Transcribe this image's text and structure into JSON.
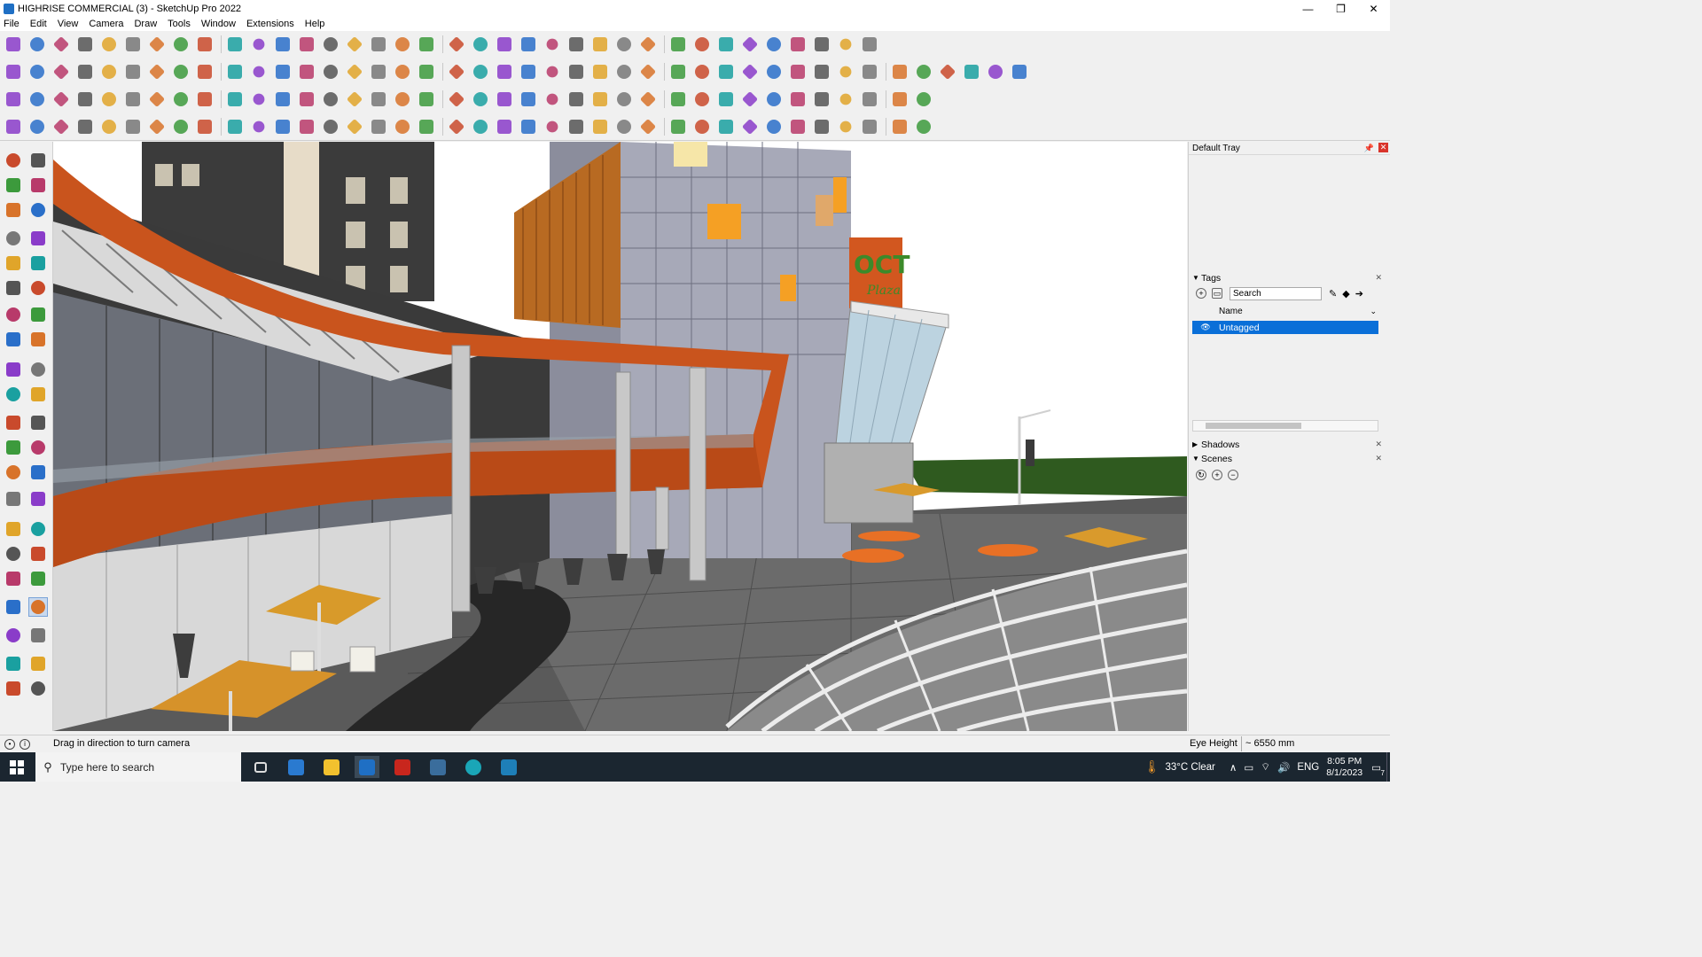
{
  "window": {
    "title": "HIGHRISE COMMERCIAL (3) - SketchUp Pro 2022",
    "controls": [
      "—",
      "❐",
      "✕"
    ]
  },
  "menu": [
    "File",
    "Edit",
    "View",
    "Camera",
    "Draw",
    "Tools",
    "Window",
    "Extensions",
    "Help"
  ],
  "viewport": {
    "signage": "OCT",
    "signage_script": "Plaza"
  },
  "tray": {
    "title": "Default Tray",
    "pin_glyph": "📌",
    "close_glyph": "✕",
    "tags": {
      "title": "Tags",
      "search_placeholder": "Search",
      "column_header": "Name",
      "items": [
        {
          "name": "Untagged",
          "visible": true
        }
      ]
    },
    "shadows": {
      "title": "Shadows"
    },
    "scenes": {
      "title": "Scenes"
    }
  },
  "status": {
    "message": "Drag in direction to turn camera",
    "measure_label": "Eye Height",
    "measure_value": "~ 6550 mm"
  },
  "taskbar": {
    "search_placeholder": "Type here to search",
    "weather": "33°C  Clear",
    "language": "ENG",
    "time": "8:05 PM",
    "date": "8/1/2023",
    "notification_count": "7"
  }
}
